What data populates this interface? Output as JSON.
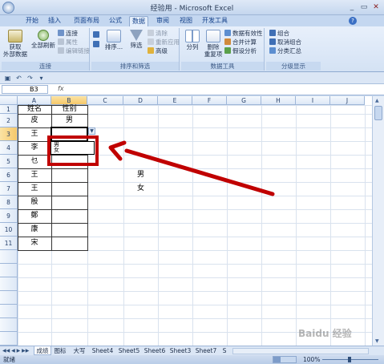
{
  "window": {
    "title": "经验用 - Microsoft Excel",
    "minimize": "_",
    "restore": "▭",
    "close": "✕"
  },
  "ribbon_tabs": [
    "开始",
    "插入",
    "页面布局",
    "公式",
    "数据",
    "审阅",
    "视图",
    "开发工具"
  ],
  "active_tab": "数据",
  "ribbon": {
    "groups": [
      {
        "label": "连接",
        "big": [
          {
            "label": "获取\n外部数据"
          },
          {
            "label": "全部刷新"
          }
        ],
        "small": [
          "连接",
          "属性",
          "编辑链接"
        ]
      },
      {
        "label": "排序和筛选",
        "big": [
          {
            "label": "排序..."
          },
          {
            "label": "筛选"
          }
        ],
        "small": [
          "清除",
          "重新应用",
          "高级"
        ]
      },
      {
        "label": "数据工具",
        "big": [
          {
            "label": "分列"
          },
          {
            "label": "删除\n重复项"
          }
        ],
        "small": [
          "数据有效性",
          "合并计算",
          "假设分析"
        ]
      },
      {
        "label": "分级显示",
        "small": [
          "组合",
          "取消组合",
          "分类汇总"
        ]
      }
    ]
  },
  "formula_bar": {
    "name_box": "B3",
    "fx": "fx",
    "value": ""
  },
  "columns": [
    "A",
    "B",
    "C",
    "D",
    "E",
    "F",
    "G",
    "H",
    "I",
    "J"
  ],
  "rows": [
    "1",
    "2",
    "3",
    "4",
    "5",
    "6",
    "7",
    "8",
    "9",
    "10",
    "11"
  ],
  "selected_cell": {
    "col": "B",
    "row": "3"
  },
  "cells": {
    "A1": "姓名",
    "B1": "性别",
    "A2": "皮",
    "B2": "男",
    "A3": "王",
    "A4": "李",
    "A5": "乜",
    "A6": "王",
    "A7": "王",
    "A8": "殷",
    "A9": "鄭",
    "A10": "康",
    "A11": "宋",
    "D6": "男",
    "D7": "女"
  },
  "dropdown": {
    "options": [
      "男",
      "女"
    ]
  },
  "sheets": [
    "成绩",
    "图标",
    "大写",
    "Sheet4",
    "Sheet5",
    "Sheet6",
    "Sheet3",
    "Sheet7",
    "S"
  ],
  "active_sheet": "成绩",
  "status": {
    "ready": "就绪",
    "zoom": "100%"
  },
  "watermark": "Baidu 经验",
  "colors": {
    "highlight": "#c00000",
    "arrow": "#c00000"
  }
}
